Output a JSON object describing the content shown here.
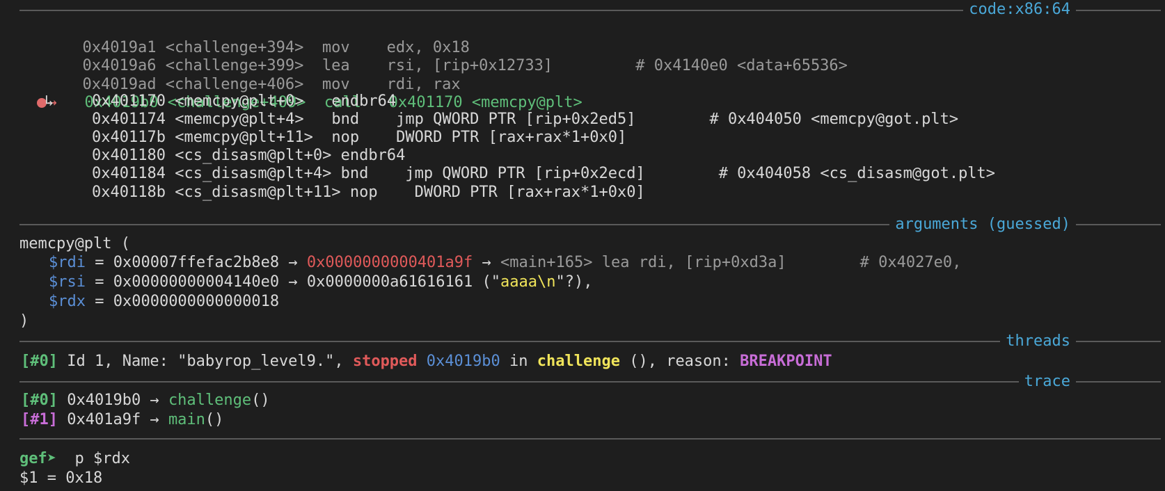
{
  "code_section": {
    "title": "code:x86:64",
    "lines": [
      {
        "addr": "0x4019a1",
        "sym": "<challenge+394>",
        "mnem": "mov",
        "ops": "edx, 0x18",
        "comment": ""
      },
      {
        "addr": "0x4019a6",
        "sym": "<challenge+399>",
        "mnem": "lea",
        "ops": "rsi, [rip+0x12733]",
        "comment": "# 0x4140e0 <data+65536>"
      },
      {
        "addr": "0x4019ad",
        "sym": "<challenge+406>",
        "mnem": "mov",
        "ops": "rdi, rax",
        "comment": ""
      }
    ],
    "current": {
      "marker": "→",
      "addr": "0x4019b0",
      "sym": "<challenge+409>",
      "mnem": "call",
      "ops": "0x401170 <memcpy@plt>"
    },
    "branch_arrow": "↳",
    "plt_lines": [
      {
        "addr": "0x401170",
        "sym": "<memcpy@plt+0>",
        "rest": "endbr64"
      },
      {
        "addr": "0x401174",
        "sym": "<memcpy@plt+4>",
        "rest": "bnd    jmp QWORD PTR [rip+0x2ed5]        # 0x404050 <memcpy@got.plt>"
      },
      {
        "addr": "0x40117b",
        "sym": "<memcpy@plt+11>",
        "rest": "nop    DWORD PTR [rax+rax*1+0x0]"
      },
      {
        "addr": "0x401180",
        "sym": "<cs_disasm@plt+0>",
        "rest": "endbr64"
      },
      {
        "addr": "0x401184",
        "sym": "<cs_disasm@plt+4>",
        "rest": "bnd    jmp QWORD PTR [rip+0x2ecd]        # 0x404058 <cs_disasm@got.plt>"
      },
      {
        "addr": "0x40118b",
        "sym": "<cs_disasm@plt+11>",
        "rest": "nop    DWORD PTR [rax+rax*1+0x0]"
      }
    ]
  },
  "arguments_section": {
    "title": "arguments (guessed)",
    "call": "memcpy@plt (",
    "close": ")",
    "rdi": {
      "reg": "$rdi",
      "val": " = 0x00007ffefac2b8e8 → ",
      "ptr": "0x0000000000401a9f",
      "arrow": " → ",
      "tail": "<main+165> lea rdi, [rip+0xd3a]",
      "comment": "        # 0x4027e0,"
    },
    "rsi": {
      "reg": "$rsi",
      "val": " = 0x00000000004140e0 → 0x0000000a61616161 (\"",
      "str": "aaaa\\n",
      "end": "\"?),"
    },
    "rdx": {
      "reg": "$rdx",
      "val": " = 0x0000000000000018"
    }
  },
  "threads_section": {
    "title": "threads",
    "id": "[#0]",
    "desc": " Id 1, Name: \"babyrop_level9.\", ",
    "state": "stopped",
    "addr": "0x4019b0",
    "in": " in ",
    "func": "challenge",
    "reason_label": " (), reason: ",
    "reason": "BREAKPOINT"
  },
  "trace_section": {
    "title": "trace",
    "frames": [
      {
        "id": "[#0]",
        "addr": " 0x4019b0 → ",
        "func": "challenge",
        "args": "()"
      },
      {
        "id": "[#1]",
        "addr": " 0x401a9f → ",
        "func": "main",
        "args": "()"
      }
    ]
  },
  "prompt": {
    "label": "gef➤",
    "command": "  p $rdx",
    "output": "$1 = 0x18"
  },
  "colors": {
    "background": "#1e1e1e",
    "section_title": "#4aa8d8",
    "current_line": "#5fbf7a",
    "register": "#5b8fd6",
    "code_pointer": "#e05a5a",
    "string": "#f0e45a",
    "breakpoint": "#c86dd7"
  }
}
